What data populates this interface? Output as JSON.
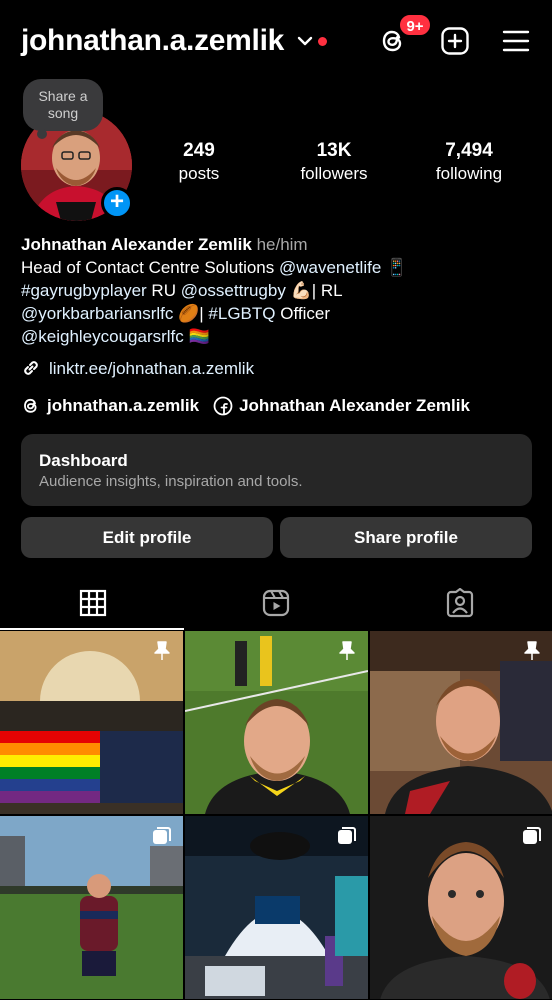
{
  "header": {
    "username": "johnathan.a.zemlik",
    "notification_badge": "9+"
  },
  "note": {
    "text": "Share a song"
  },
  "stats": {
    "posts": {
      "value": "249",
      "label": "posts"
    },
    "followers": {
      "value": "13K",
      "label": "followers"
    },
    "following": {
      "value": "7,494",
      "label": "following"
    }
  },
  "bio": {
    "full_name": "Johnathan Alexander Zemlik",
    "pronouns": "he/him",
    "line1_text": "Head of Contact Centre Solutions ",
    "line1_mention": "@wavenetlife",
    "line1_emoji": "📱",
    "line2_tag": "#gayrugbyplayer",
    "line2_text": " RU ",
    "line2_mention": "@ossettrugby",
    "line2_emoji": "💪🏻",
    "line2_end": "| RL",
    "line3_mention": "@yorkbarbariansrlfc",
    "line3_emoji": "🏉",
    "line3_mid": "| ",
    "line3_tag": "#LGBTQ",
    "line3_end": " Officer",
    "line4_mention": "@keighleycougarsrlfc",
    "line4_emoji": "🏳️‍🌈",
    "link": "linktr.ee/johnathan.a.zemlik"
  },
  "social": {
    "threads": "johnathan.a.zemlik",
    "facebook": "Johnathan Alexander Zemlik"
  },
  "dashboard": {
    "title": "Dashboard",
    "subtitle": "Audience insights, inspiration and tools."
  },
  "buttons": {
    "edit": "Edit profile",
    "share": "Share profile"
  },
  "icons": {
    "header": [
      "chevron-down-icon",
      "threads-icon",
      "new-post-icon",
      "menu-icon"
    ],
    "tabs": [
      "grid-icon",
      "reels-icon",
      "tagged-icon"
    ],
    "tile_overlays": [
      "pin-icon",
      "pin-icon",
      "pin-icon",
      "carousel-icon",
      "carousel-icon",
      "carousel-icon"
    ]
  },
  "colors": {
    "accent_blue": "#0095f6",
    "badge_red": "#ff3040",
    "button_bg": "#363636",
    "card_bg": "#262626"
  }
}
